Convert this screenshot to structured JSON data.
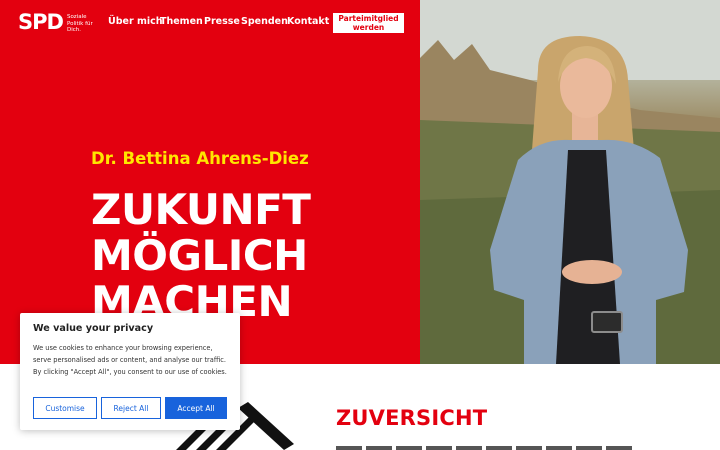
{
  "nav": {
    "logo": "SPD",
    "tagline": "Soziale Politik für Dich.",
    "links": [
      "Über mich",
      "Themen",
      "Presse",
      "Spenden",
      "Kontakt"
    ],
    "cta": "Parteimitglied werden"
  },
  "hero": {
    "name": "Dr. Bettina Ahrens-Diez",
    "headline": [
      "ZUKUNFT",
      "MÖGLICH",
      "MACHEN"
    ]
  },
  "section": {
    "title": "ZUVERSICHT"
  },
  "cookie": {
    "title": "We value your privacy",
    "text": "We use cookies to enhance your browsing experience, serve personalised ads or content, and analyse our traffic. By clicking \"Accept All\", you consent to our use of cookies.",
    "buttons": {
      "customise": "Customise",
      "reject": "Reject All",
      "accept": "Accept All"
    }
  },
  "colors": {
    "brand_red": "#e3000f",
    "name_yellow": "#ffe600",
    "cookie_blue": "#1863dc"
  }
}
